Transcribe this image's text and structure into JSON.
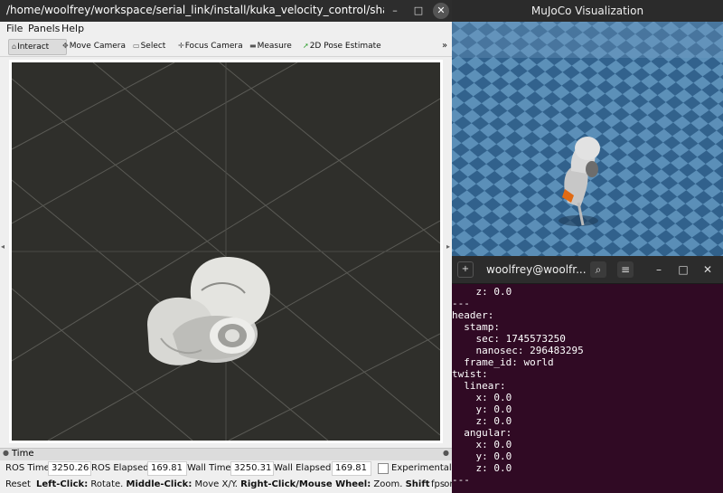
{
  "rviz": {
    "title": "/home/woolfrey/workspace/serial_link/install/kuka_velocity_control/share/kuka_...",
    "window_controls": {
      "minimize": "–",
      "maximize": "□",
      "close": "✕"
    },
    "menu": [
      "File",
      "Panels",
      "Help"
    ],
    "tools": [
      {
        "label": "Interact",
        "icon": "cursor-icon"
      },
      {
        "label": "Move Camera",
        "icon": "move-icon"
      },
      {
        "label": "Select",
        "icon": "select-icon"
      },
      {
        "label": "Focus Camera",
        "icon": "focus-icon"
      },
      {
        "label": "Measure",
        "icon": "ruler-icon"
      },
      {
        "label": "2D Pose Estimate",
        "icon": "pose-arrow-icon"
      }
    ],
    "toolbar_overflow": "»",
    "time_panel": {
      "title": "Time",
      "ros_time_label": "ROS Time:",
      "ros_time": "3250.26",
      "ros_elapsed_label": "ROS Elapsed:",
      "ros_elapsed": "169.81",
      "wall_time_label": "Wall Time:",
      "wall_time": "3250.31",
      "wall_elapsed_label": "Wall Elapsed:",
      "wall_elapsed": "169.81",
      "experimental_label": "Experimental"
    },
    "status": {
      "reset": "Reset",
      "left_click": "Left-Click:",
      "left_click_desc": " Rotate. ",
      "middle_click": "Middle-Click:",
      "middle_click_desc": " Move X/Y. ",
      "right_click": "Right-Click/Mouse Wheel:",
      "right_click_desc": " Zoom. ",
      "shift": "Shift:",
      "shift_desc": " More op",
      "fps": "fps"
    }
  },
  "mujoco": {
    "title": "MuJoCo Visualization"
  },
  "terminal": {
    "title": "woolfrey@woolfr...",
    "lines": [
      "    z: 0.0",
      "---",
      "header:",
      "  stamp:",
      "    sec: 1745573250",
      "    nanosec: 296483295",
      "  frame_id: world",
      "twist:",
      "  linear:",
      "    x: 0.0",
      "    y: 0.0",
      "    z: 0.0",
      "  angular:",
      "    x: 0.0",
      "    y: 0.0",
      "    z: 0.0",
      "---"
    ]
  }
}
